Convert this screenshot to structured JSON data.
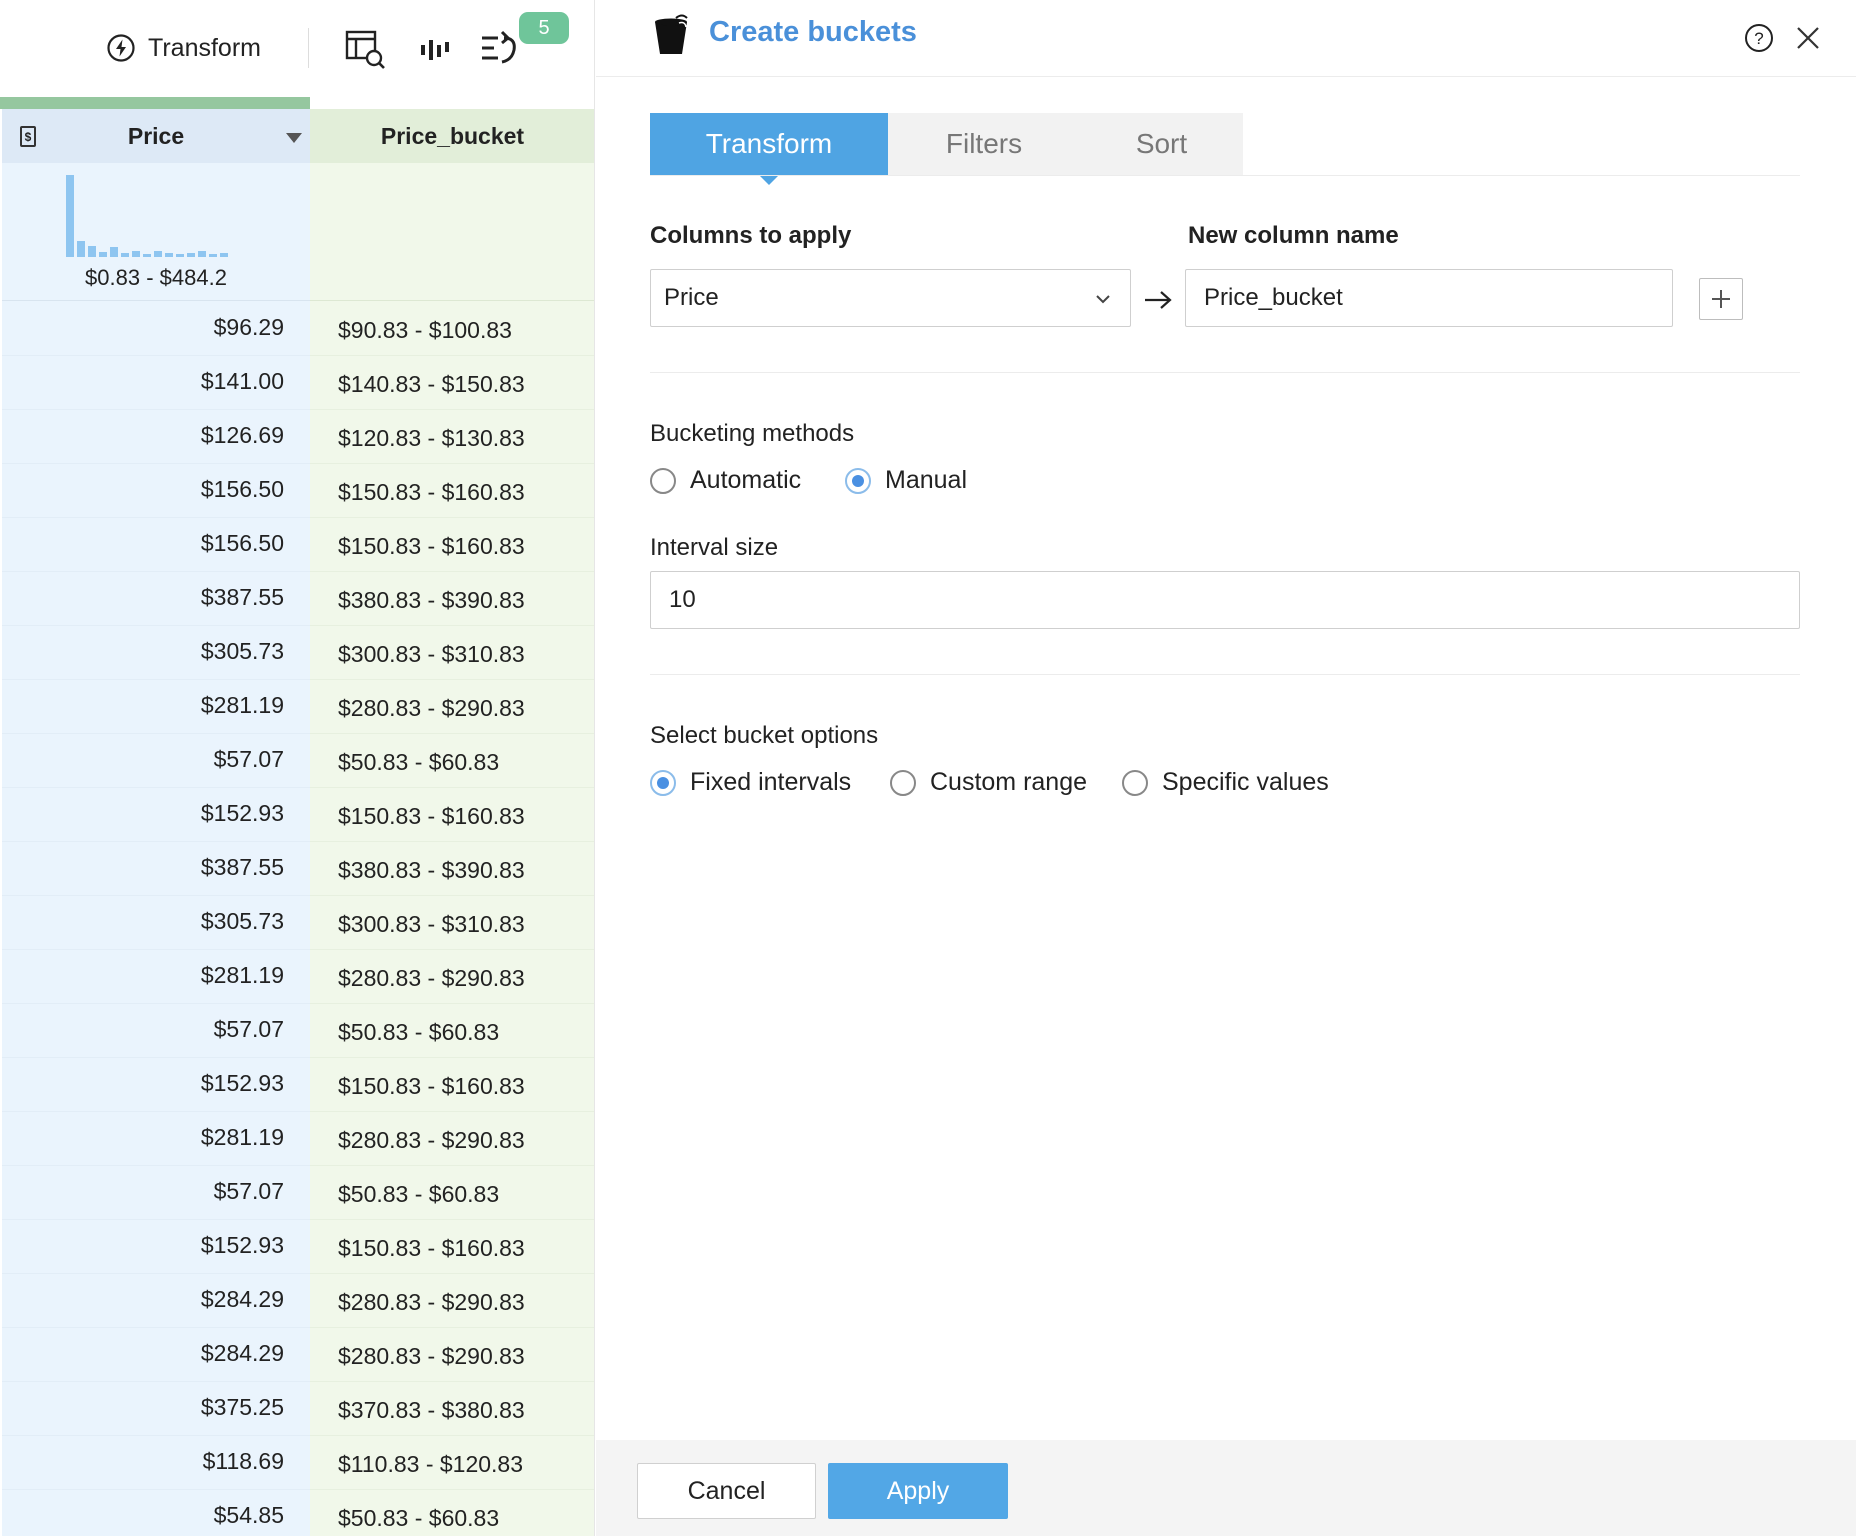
{
  "toolbar": {
    "transform_label": "Transform",
    "badge_count": "5",
    "icons": [
      "lightning-icon",
      "table-search-icon",
      "histogram-icon",
      "steps-undo-icon"
    ]
  },
  "grid": {
    "columns": [
      {
        "name": "Price",
        "type_icon": "currency-icon"
      },
      {
        "name": "Price_bucket"
      }
    ],
    "price_histogram": {
      "range_label": "$0.83 - $484.2",
      "bins": [
        1.0,
        0.2,
        0.13,
        0.06,
        0.12,
        0.05,
        0.07,
        0.03,
        0.07,
        0.05,
        0.04,
        0.05,
        0.07,
        0.04,
        0.05
      ]
    },
    "rows": [
      {
        "price": "$96.29",
        "bucket": "$90.83 - $100.83"
      },
      {
        "price": "$141.00",
        "bucket": "$140.83 - $150.83"
      },
      {
        "price": "$126.69",
        "bucket": "$120.83 - $130.83"
      },
      {
        "price": "$156.50",
        "bucket": "$150.83 - $160.83"
      },
      {
        "price": "$156.50",
        "bucket": "$150.83 - $160.83"
      },
      {
        "price": "$387.55",
        "bucket": "$380.83 - $390.83"
      },
      {
        "price": "$305.73",
        "bucket": "$300.83 - $310.83"
      },
      {
        "price": "$281.19",
        "bucket": "$280.83 - $290.83"
      },
      {
        "price": "$57.07",
        "bucket": "$50.83 - $60.83"
      },
      {
        "price": "$152.93",
        "bucket": "$150.83 - $160.83"
      },
      {
        "price": "$387.55",
        "bucket": "$380.83 - $390.83"
      },
      {
        "price": "$305.73",
        "bucket": "$300.83 - $310.83"
      },
      {
        "price": "$281.19",
        "bucket": "$280.83 - $290.83"
      },
      {
        "price": "$57.07",
        "bucket": "$50.83 - $60.83"
      },
      {
        "price": "$152.93",
        "bucket": "$150.83 - $160.83"
      },
      {
        "price": "$281.19",
        "bucket": "$280.83 - $290.83"
      },
      {
        "price": "$57.07",
        "bucket": "$50.83 - $60.83"
      },
      {
        "price": "$152.93",
        "bucket": "$150.83 - $160.83"
      },
      {
        "price": "$284.29",
        "bucket": "$280.83 - $290.83"
      },
      {
        "price": "$284.29",
        "bucket": "$280.83 - $290.83"
      },
      {
        "price": "$375.25",
        "bucket": "$370.83 - $380.83"
      },
      {
        "price": "$118.69",
        "bucket": "$110.83 - $120.83"
      },
      {
        "price": "$54.85",
        "bucket": "$50.83 - $60.83"
      }
    ]
  },
  "panel": {
    "title": "Create buckets",
    "tabs": [
      {
        "label": "Transform",
        "active": true
      },
      {
        "label": "Filters",
        "active": false
      },
      {
        "label": "Sort",
        "active": false
      }
    ],
    "columns_to_apply_label": "Columns to apply",
    "columns_to_apply_value": "Price",
    "new_column_name_label": "New column name",
    "new_column_name_value": "Price_bucket",
    "bucketing_methods_label": "Bucketing methods",
    "bucketing_methods": [
      {
        "label": "Automatic",
        "selected": false
      },
      {
        "label": "Manual",
        "selected": true
      }
    ],
    "interval_size_label": "Interval size",
    "interval_size_value": "10",
    "bucket_options_label": "Select bucket options",
    "bucket_options": [
      {
        "label": "Fixed intervals",
        "selected": true
      },
      {
        "label": "Custom range",
        "selected": false
      },
      {
        "label": "Specific values",
        "selected": false
      }
    ],
    "cancel_label": "Cancel",
    "apply_label": "Apply"
  },
  "colors": {
    "accent": "#4a90d9",
    "tab_active": "#4fa4e3",
    "badge": "#6fc59a",
    "price_col_bg": "#eaf4fd",
    "bucket_col_bg": "#f1f8ea",
    "histogram_bar": "#8ec5f0"
  }
}
